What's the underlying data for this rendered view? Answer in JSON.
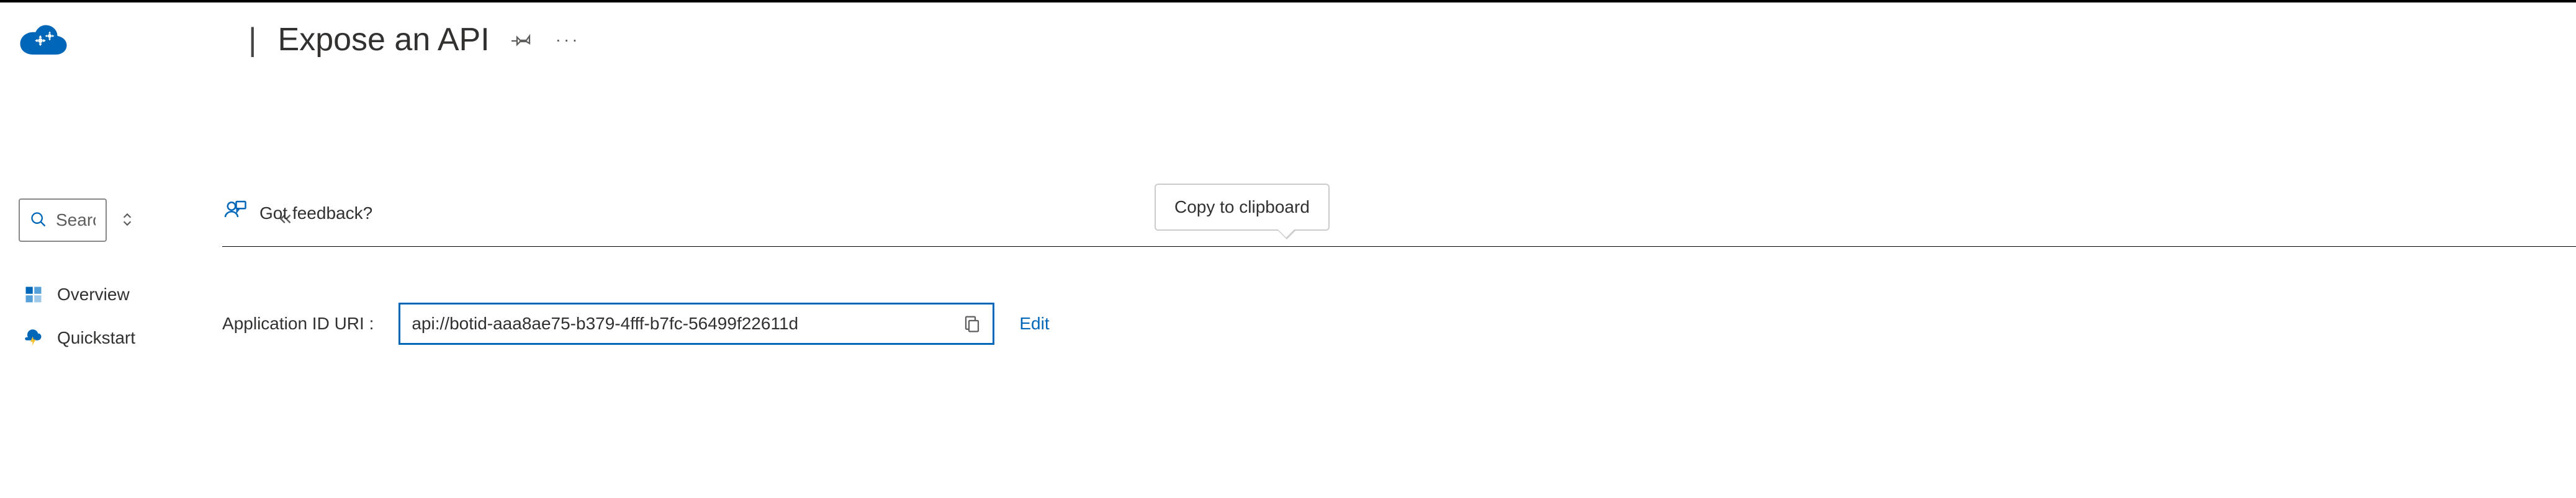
{
  "header": {
    "page_title": "Expose an API"
  },
  "sidebar": {
    "search_placeholder": "Search",
    "items": [
      {
        "label": "Overview",
        "icon": "overview"
      },
      {
        "label": "Quickstart",
        "icon": "quickstart"
      }
    ]
  },
  "main": {
    "feedback_label": "Got feedback?",
    "uri_label": "Application ID URI :",
    "uri_value": "api://botid-aaa8ae75-b379-4fff-b7fc-56499f22611d",
    "edit_label": "Edit",
    "tooltip": "Copy to clipboard"
  }
}
